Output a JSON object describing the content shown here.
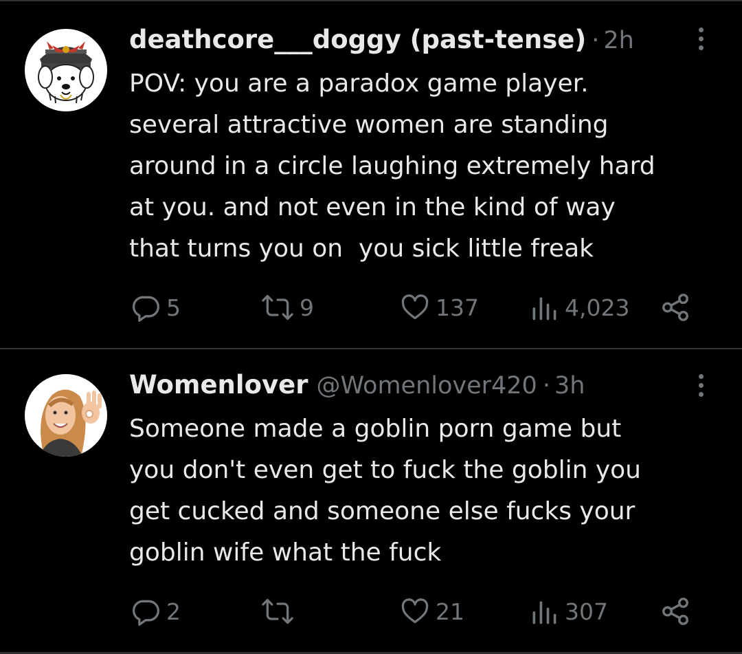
{
  "tweets": [
    {
      "display_name": "deathcore___doggy (past-tense)",
      "handle": "",
      "separator": "·",
      "time": "2h",
      "avatar_icon": "dog-samurai-avatar",
      "body_lines": [
        "POV: you are a paradox game player.",
        "several attractive women are standing",
        "around in a circle laughing extremely hard",
        "at you. and not even in the kind of way",
        "that turns you on  you sick little freak"
      ],
      "replies": "5",
      "retweets": "9",
      "likes": "137",
      "views": "4,023"
    },
    {
      "display_name": "Womenlover",
      "handle": "@Womenlover420",
      "separator": "·",
      "time": "3h",
      "avatar_icon": "woman-portrait-avatar",
      "body_lines": [
        "Someone made a goblin porn game but",
        "you don't even get to fuck the goblin you",
        "get cucked and someone else fucks your",
        "goblin wife what the fuck"
      ],
      "replies": "2",
      "retweets": "",
      "likes": "21",
      "views": "307"
    }
  ],
  "colors": {
    "background": "#000000",
    "primary_text": "#e7e9ea",
    "secondary_text": "#71767b",
    "divider": "#2f3336"
  }
}
